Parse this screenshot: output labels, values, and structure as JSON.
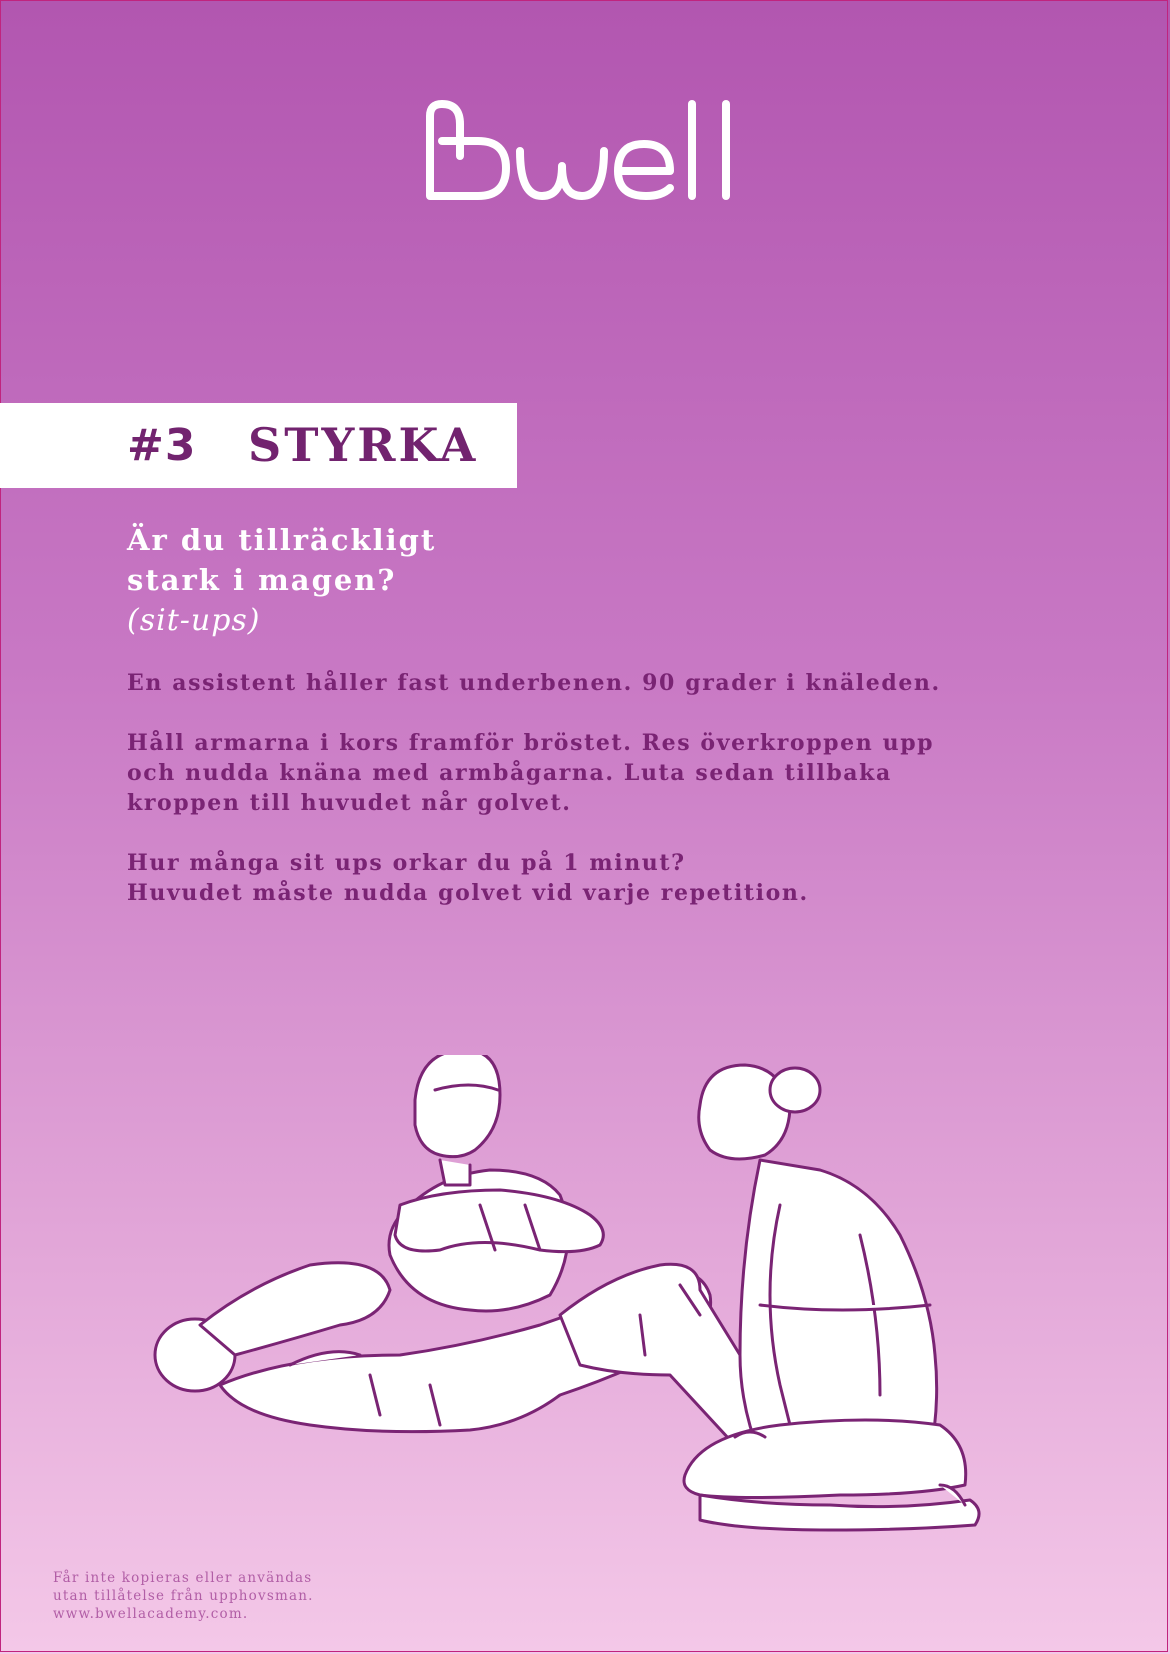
{
  "brand": {
    "logo_text": "Bwell"
  },
  "banner": {
    "number": "#3",
    "title": "STYRKA"
  },
  "heading": {
    "line1": "Är du tillräckligt",
    "line2": "stark i magen?",
    "subtitle": "(sit-ups)"
  },
  "body": {
    "p1": "En assistent håller fast underbenen. 90 grader i knäleden.",
    "p2_lines": [
      "Håll armarna i kors framför bröstet. Res överkroppen upp",
      "och nudda knäna med armbågarna. Luta sedan tillbaka",
      "kroppen till huvudet når golvet."
    ],
    "p3_lines": [
      "Hur många sit ups orkar du på 1 minut?",
      "Huvudet måste nudda golvet vid varje repetition."
    ]
  },
  "footer": {
    "lines": [
      "Får inte kopieras eller användas",
      "utan tillåtelse från upphovsman.",
      "www.bwellacademy.com."
    ]
  },
  "colors": {
    "accent": "#72236f",
    "gradient_top": "#b256b0",
    "gradient_bottom": "#f4c8e8",
    "border": "#c0247e"
  },
  "illustration": {
    "icon": "sit-ups-illustration-icon"
  }
}
